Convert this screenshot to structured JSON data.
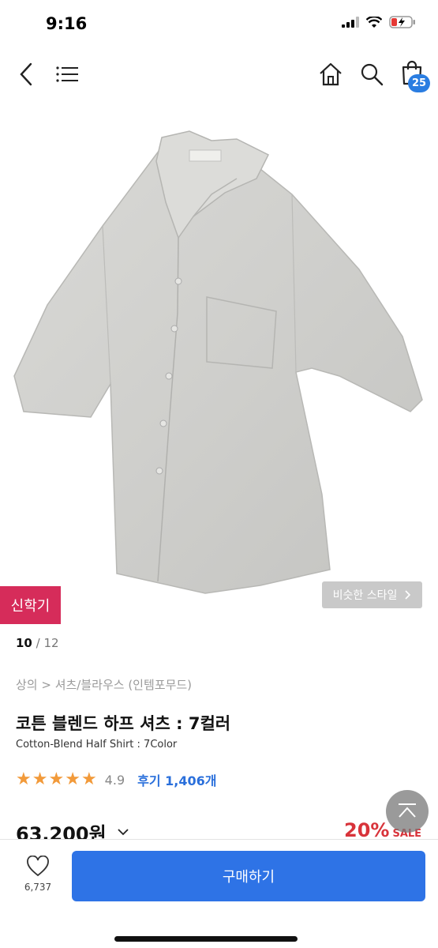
{
  "status_bar": {
    "time": "9:16"
  },
  "nav": {
    "cart_count": "25"
  },
  "gallery": {
    "badge": "신학기",
    "similar_style": "비슷한 스타일",
    "current_index": "10",
    "total_sep": " / ",
    "total": "12"
  },
  "product": {
    "breadcrumb": "상의 > 셔츠/블라우스 (인템포무드)",
    "title_ko": "코튼 블렌드 하프 셔츠 : 7컬러",
    "title_en": "Cotton-Blend Half Shirt : 7Color",
    "rating": "4.9",
    "rating_fraction": 0.98,
    "review_link": "후기 1,406개",
    "price": "63,200원",
    "discount": "20%",
    "sale_label": "SALE"
  },
  "bottom": {
    "like_count": "6,737",
    "buy_label": "구매하기"
  },
  "colors": {
    "accent_blue": "#2e73e6",
    "badge_pink": "#d62c5a",
    "sale_red": "#d8333a",
    "star_orange": "#f29a3a"
  }
}
